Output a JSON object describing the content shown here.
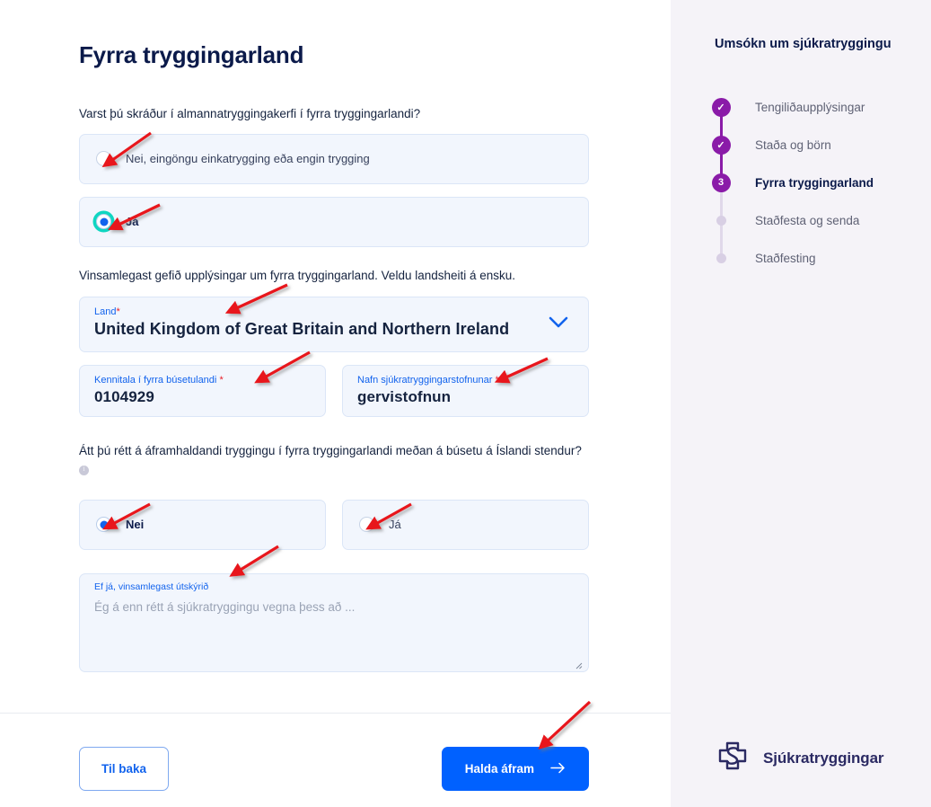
{
  "page": {
    "title": "Fyrra tryggingarland"
  },
  "questions": {
    "q1": {
      "text": "Varst þú skráður í almannatryggingakerfi í fyrra tryggingarlandi?",
      "options": [
        {
          "label": "Nei, eingöngu einkatrygging eða engin trygging",
          "selected": false,
          "focused": false
        },
        {
          "label": "Já",
          "selected": true,
          "focused": true
        }
      ]
    },
    "q2": {
      "text": "Átt þú rétt á áframhaldandi tryggingu í fyrra tryggingarlandi meðan á búsetu á Íslandi stendur?",
      "info_icon": "info-icon",
      "options": [
        {
          "label": "Nei",
          "selected": true,
          "focused": false
        },
        {
          "label": "Já",
          "selected": false,
          "focused": false
        }
      ]
    }
  },
  "instruction": "Vinsamlegast gefið upplýsingar um fyrra tryggingarland. Veldu landsheiti á ensku.",
  "fields": {
    "country": {
      "label": "Land",
      "required": "*",
      "value": "United Kingdom of Great Britain and Northern Ireland",
      "chevron": "chevron-down-icon"
    },
    "national_id": {
      "label": "Kennitala í fyrra búsetulandi",
      "required": "*",
      "value": "0104929"
    },
    "institution": {
      "label": "Nafn sjúkratryggingarstofnunar",
      "required": "*",
      "value": "gervistofnun"
    },
    "explanation": {
      "label": "Ef já, vinsamlegast útskýrið",
      "placeholder": "Ég á enn rétt á sjúkratryggingu vegna þess að ...",
      "value": ""
    }
  },
  "footer": {
    "back_label": "Til baka",
    "next_label": "Halda áfram",
    "next_icon": "arrow-right-icon"
  },
  "sidebar": {
    "title": "Umsókn um sjúkratryggingu",
    "steps": [
      {
        "label": "Tengiliðaupplýsingar",
        "state": "done",
        "marker": "✓"
      },
      {
        "label": "Staða og börn",
        "state": "done",
        "marker": "✓"
      },
      {
        "label": "Fyrra tryggingarland",
        "state": "current",
        "marker": "3"
      },
      {
        "label": "Staðfesta og senda",
        "state": "pending",
        "marker": ""
      },
      {
        "label": "Staðfesting",
        "state": "pending",
        "marker": ""
      }
    ],
    "brand": {
      "name": "Sjúkratryggingar",
      "logo": "cross-s-logo-icon"
    }
  },
  "colors": {
    "primary_blue": "#0061ff",
    "link_blue": "#1263ed",
    "purple": "#8a1ba8",
    "navy": "#0b1a4a",
    "field_bg": "#f2f6fd",
    "sidebar_bg": "#f5f3f8",
    "focus_teal": "#0fd6c1",
    "required_red": "#e8202a",
    "annotation_red": "#e8191b"
  }
}
